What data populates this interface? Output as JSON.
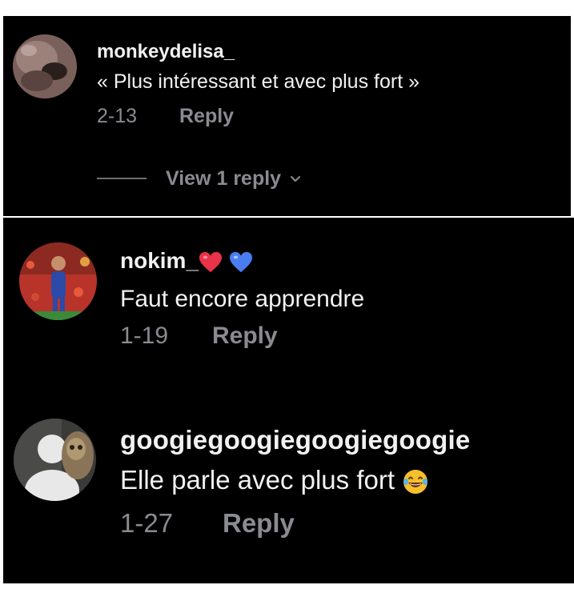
{
  "comments": [
    {
      "username": "monkeydelisa_",
      "text": "« Plus intéressant et avec plus fort »",
      "date": "2-13",
      "reply_label": "Reply",
      "view_replies_label": "View 1 reply"
    },
    {
      "username": "nokim_",
      "username_emojis": [
        "red-heart-icon",
        "blue-heart-icon"
      ],
      "text": "Faut encore apprendre",
      "date": "1-19",
      "reply_label": "Reply"
    },
    {
      "username": "googiegoogiegoogiegoogie",
      "text": "Elle parle avec plus fort",
      "text_emoji": "laughing-tears-icon",
      "date": "1-27",
      "reply_label": "Reply"
    }
  ],
  "colors": {
    "background": "#000000",
    "primary_text": "#f1f1f1",
    "secondary_text": "#8a8b91",
    "red_heart": "#e8334a",
    "blue_heart": "#4a7ef0"
  }
}
